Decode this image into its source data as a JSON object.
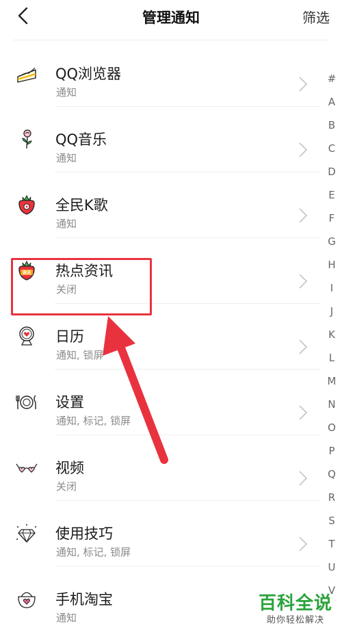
{
  "header": {
    "title": "管理通知",
    "filter_label": "筛选"
  },
  "apps": [
    {
      "name": "QQ浏览器",
      "status": "通知",
      "icon": "cake-slice-icon"
    },
    {
      "name": "QQ音乐",
      "status": "通知",
      "icon": "rose-icon"
    },
    {
      "name": "全民K歌",
      "status": "通知",
      "icon": "strawberry-icon"
    },
    {
      "name": "热点资讯",
      "status": "关闭",
      "icon": "strawberry-news-icon",
      "icon_text": "资讯"
    },
    {
      "name": "日历",
      "status": "通知, 锁屏",
      "icon": "heart-mirror-icon"
    },
    {
      "name": "设置",
      "status": "通知, 标记, 锁屏",
      "icon": "cutlery-icon"
    },
    {
      "name": "视频",
      "status": "关闭",
      "icon": "heart-glasses-icon"
    },
    {
      "name": "使用技巧",
      "status": "通知, 标记, 锁屏",
      "icon": "diamond-icon"
    },
    {
      "name": "手机淘宝",
      "status": "通知",
      "icon": "heart-basket-icon"
    }
  ],
  "index_letters": [
    "#",
    "A",
    "B",
    "C",
    "D",
    "E",
    "F",
    "G",
    "H",
    "I",
    "J",
    "K",
    "L",
    "M",
    "N",
    "O",
    "P",
    "Q",
    "R",
    "S",
    "T",
    "U",
    "V"
  ],
  "watermark": {
    "main": "百科全说",
    "sub": "助你轻松解决"
  },
  "colors": {
    "highlight": "#e8333f",
    "watermark_green": "#2aa33b",
    "strawberry_red": "#e8333f",
    "leaf_green": "#3bb04a"
  }
}
